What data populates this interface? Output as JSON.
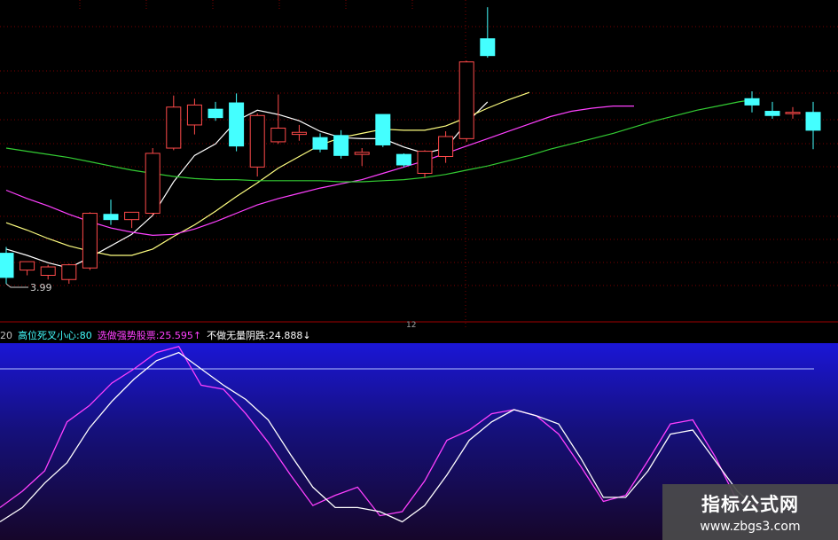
{
  "chart_data": [
    {
      "type": "candlestick",
      "title": "",
      "ylim": [
        3.8,
        6.6
      ],
      "grid": true,
      "low_label": "3.99",
      "x_marker_label": "12",
      "colors": {
        "up": "#ff4a4a",
        "down": "#44ffff",
        "ma5": "#ffffff",
        "ma10": "#ffff80",
        "ma20": "#ff40ff",
        "ma60": "#33cc33"
      },
      "candles": [
        {
          "o": 4.36,
          "h": 4.42,
          "l": 4.07,
          "c": 4.13
        },
        {
          "o": 4.2,
          "h": 4.28,
          "l": 4.15,
          "c": 4.28
        },
        {
          "o": 4.15,
          "h": 4.25,
          "l": 4.11,
          "c": 4.23
        },
        {
          "o": 4.11,
          "h": 4.26,
          "l": 4.07,
          "c": 4.25
        },
        {
          "o": 4.22,
          "h": 4.75,
          "l": 4.2,
          "c": 4.74
        },
        {
          "o": 4.73,
          "h": 4.87,
          "l": 4.63,
          "c": 4.68
        },
        {
          "o": 4.68,
          "h": 4.75,
          "l": 4.6,
          "c": 4.75
        },
        {
          "o": 4.74,
          "h": 5.36,
          "l": 4.72,
          "c": 5.31
        },
        {
          "o": 5.36,
          "h": 5.86,
          "l": 5.34,
          "c": 5.75
        },
        {
          "o": 5.58,
          "h": 5.83,
          "l": 5.49,
          "c": 5.77
        },
        {
          "o": 5.73,
          "h": 5.8,
          "l": 5.62,
          "c": 5.65
        },
        {
          "o": 5.79,
          "h": 5.88,
          "l": 5.33,
          "c": 5.38
        },
        {
          "o": 5.18,
          "h": 5.69,
          "l": 5.09,
          "c": 5.67
        },
        {
          "o": 5.42,
          "h": 5.87,
          "l": 5.4,
          "c": 5.55
        },
        {
          "o": 5.49,
          "h": 5.58,
          "l": 5.43,
          "c": 5.51
        },
        {
          "o": 5.46,
          "h": 5.5,
          "l": 5.32,
          "c": 5.35
        },
        {
          "o": 5.48,
          "h": 5.53,
          "l": 5.26,
          "c": 5.29
        },
        {
          "o": 5.3,
          "h": 5.36,
          "l": 5.19,
          "c": 5.32
        },
        {
          "o": 5.68,
          "h": 5.68,
          "l": 5.37,
          "c": 5.39
        },
        {
          "o": 5.3,
          "h": 5.31,
          "l": 5.18,
          "c": 5.2
        },
        {
          "o": 5.12,
          "h": 5.34,
          "l": 5.08,
          "c": 5.33
        },
        {
          "o": 5.28,
          "h": 5.52,
          "l": 5.22,
          "c": 5.47
        },
        {
          "o": 5.45,
          "h": 6.19,
          "l": 5.42,
          "c": 6.18
        },
        {
          "o": 6.4,
          "h": 6.7,
          "l": 6.22,
          "c": 6.24
        }
      ],
      "gap_candles": [
        {
          "o": 5.83,
          "h": 5.9,
          "l": 5.7,
          "c": 5.77
        },
        {
          "o": 5.71,
          "h": 5.8,
          "l": 5.64,
          "c": 5.67
        },
        {
          "o": 5.69,
          "h": 5.75,
          "l": 5.64,
          "c": 5.7
        },
        {
          "o": 5.7,
          "h": 5.8,
          "l": 5.35,
          "c": 5.53
        }
      ],
      "series": [
        {
          "key": "ma5",
          "values": [
            4.4,
            4.34,
            4.27,
            4.22,
            4.32,
            4.43,
            4.54,
            4.72,
            5.04,
            5.29,
            5.4,
            5.62,
            5.72,
            5.68,
            5.62,
            5.52,
            5.46,
            5.45,
            5.45,
            5.37,
            5.31,
            5.36,
            5.6,
            5.8
          ]
        },
        {
          "key": "ma10",
          "values": [
            4.65,
            4.58,
            4.5,
            4.43,
            4.38,
            4.34,
            4.34,
            4.4,
            4.52,
            4.63,
            4.76,
            4.9,
            5.03,
            5.17,
            5.28,
            5.39,
            5.46,
            5.5,
            5.54,
            5.53,
            5.53,
            5.57,
            5.65,
            5.74,
            5.82,
            5.89
          ]
        },
        {
          "key": "ma20",
          "values": [
            4.96,
            4.88,
            4.81,
            4.73,
            4.66,
            4.6,
            4.56,
            4.53,
            4.54,
            4.59,
            4.66,
            4.74,
            4.82,
            4.88,
            4.93,
            4.98,
            5.02,
            5.06,
            5.12,
            5.18,
            5.24,
            5.31,
            5.38,
            5.45,
            5.52,
            5.59,
            5.66,
            5.71,
            5.74,
            5.76,
            5.76
          ]
        },
        {
          "key": "ma60",
          "values": [
            5.36,
            5.33,
            5.3,
            5.27,
            5.23,
            5.19,
            5.15,
            5.12,
            5.09,
            5.07,
            5.06,
            5.06,
            5.05,
            5.05,
            5.05,
            5.05,
            5.04,
            5.04,
            5.05,
            5.06,
            5.08,
            5.11,
            5.15,
            5.19,
            5.24,
            5.29,
            5.35,
            5.4,
            5.45,
            5.5,
            5.56,
            5.62,
            5.67,
            5.72,
            5.76,
            5.8,
            5.83
          ]
        }
      ]
    },
    {
      "type": "line",
      "title": "",
      "ylim": [
        0,
        100
      ],
      "reference_line": 80,
      "legend": {
        "prefix": "20",
        "items": [
          {
            "text": "高位死叉小心:80",
            "color": "#44ffff"
          },
          {
            "text": "选做强势股票:25.595↑",
            "color": "#ff40ff"
          },
          {
            "text": "不做无量阴跌:24.888↓",
            "color": "#ffffff"
          }
        ]
      },
      "series": [
        {
          "color": "#ff40ff",
          "values": [
            12,
            20,
            30,
            54,
            62,
            73,
            80,
            88,
            91,
            72,
            70,
            58,
            44,
            28,
            13,
            18,
            22,
            8,
            10,
            25,
            45,
            50,
            58,
            60,
            57,
            48,
            32,
            15,
            18,
            35,
            53,
            55,
            37,
            15,
            13
          ]
        },
        {
          "color": "#ffffff",
          "values": [
            5,
            12,
            24,
            34,
            51,
            64,
            75,
            84,
            88,
            80,
            72,
            65,
            55,
            38,
            22,
            12,
            12,
            10,
            5,
            13,
            28,
            45,
            54,
            60,
            57,
            53,
            36,
            17,
            17,
            30,
            48,
            50,
            35,
            20,
            10
          ]
        }
      ]
    }
  ],
  "watermark": {
    "main": "指标公式网",
    "url": "www.zbgs3.com"
  }
}
